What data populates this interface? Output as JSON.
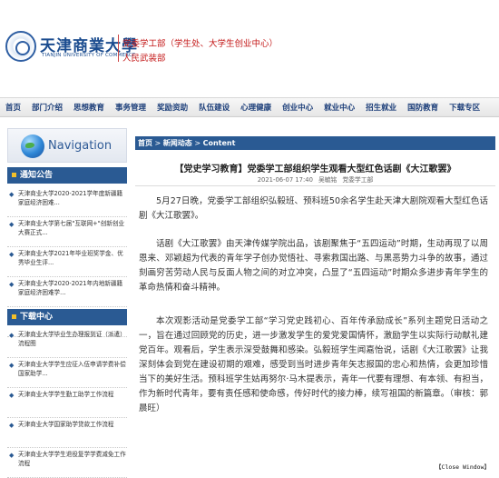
{
  "header": {
    "logo_cn": "天津商業大學",
    "logo_en": "TIANJIN UNIVERSITY OF COMMERCE",
    "dept_line1": "党委学工部（学生处、大学生创业中心）",
    "dept_line2": "人民武装部"
  },
  "nav": {
    "items": [
      "首页",
      "部门介绍",
      "思想教育",
      "事务管理",
      "奖励资助",
      "队伍建设",
      "心理健康",
      "创业中心",
      "就业中心",
      "招生就业",
      "国防教育",
      "下载专区"
    ]
  },
  "sidebar": {
    "nav_title": "Navigation",
    "notice_title": "通知公告",
    "notices": [
      "天津商业大学2020-2021学年度新疆籍家庭经济困难...",
      "天津商业大学第七届\"互联网+\"创新创业大赛正式...",
      "天津商业大学2021年毕业班奖学金、优秀毕业生评...",
      "天津商业大学2020-2021年内地新疆籍家庭经济困难学...",
      "关于举办2021年学生资助宣传大使选拔赛的工作通..."
    ],
    "download_title": "下载中心",
    "downloads": [
      "天津商业大学毕业生办理报到证（派遣）流程图",
      "天津商业大学学生应征入伍申请学费补偿国家助学...",
      "天津商业大学学生勤工助学工作流程",
      "天津商业大学国家助学贷款工作流程",
      "天津商业大学学生退役复学学费减免工作流程"
    ]
  },
  "breadcrumb": {
    "home": "首页",
    "sep1": " > ",
    "news": "新闻动态",
    "sep2": " > ",
    "content": "Content"
  },
  "article": {
    "title": "【党史学习教育】党委学工部组织学生观看大型红色话剧《大江歌罢》",
    "date": "2021-06-07 17:40",
    "author": "吴毓铭",
    "source": "党委学工部",
    "p1": "5月27日晚，党委学工部组织弘毅班、预科班50余名学生赴天津大剧院观看大型红色话剧《大江歌罢》。",
    "p2": "话剧《大江歌罢》由天津传媒学院出品，该剧聚焦于“五四运动”时期，生动再现了以周恩来、邓颖超为代表的青年学子创办觉悟社、寻索救国出路、与黑恶势力斗争的故事，通过刻画穷苦劳动人民与反面人物之间的对立冲突，凸显了“五四运动”时期众多进步青年学生的革命热情和奋斗精神。",
    "p3": "本次观影活动是党委学工部“学习党史践初心、百年传承励成长”系列主题党日活动之一，旨在通过回顾党的历史，进一步激发学生的爱党爱国情怀，激励学生以实际行动献礼建党百年。观看后，学生表示深受鼓舞和感染。弘毅班学生闻嘉怡说，话剧《大江歌罢》让我深刻体会到党在建设初期的艰难，感受到当时进步青年矢志报国的忠心和热情，会更加珍惜当下的美好生活。预科班学生姑再努尔·马木提表示，青年一代要有理想、有本领、有担当，作为新时代青年，要有责任感和使命感，传好时代的接力棒，续写祖国的新篇章。（审核：郭晨旺）"
  },
  "close_label": "【Close Window】"
}
